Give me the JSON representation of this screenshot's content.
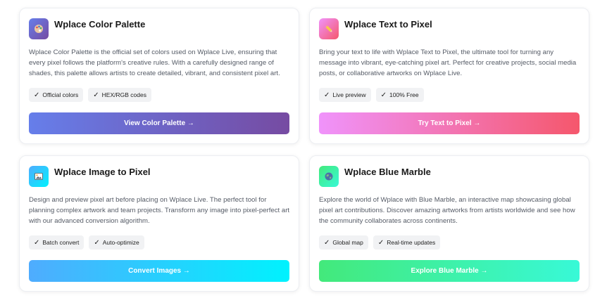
{
  "cards": [
    {
      "title": "Wplace Color Palette",
      "description": "Wplace Color Palette is the official set of colors used on Wplace Live, ensuring that every pixel follows the platform's creative rules. With a carefully designed range of shades, this palette allows artists to create detailed, vibrant, and consistent pixel art.",
      "tags": [
        "Official colors",
        "HEX/RGB codes"
      ],
      "button": "View Color Palette →",
      "icon": "palette-icon",
      "colors": {
        "gradient_start": "#667eea",
        "gradient_end": "#764ba2"
      }
    },
    {
      "title": "Wplace Text to Pixel",
      "description": "Bring your text to life with Wplace Text to Pixel, the ultimate tool for turning any message into vibrant, eye-catching pixel art. Perfect for creative projects, social media posts, or collaborative artworks on Wplace Live.",
      "tags": [
        "Live preview",
        "100% Free"
      ],
      "button": "Try Text to Pixel →",
      "icon": "pencil-icon",
      "colors": {
        "gradient_start": "#f093fb",
        "gradient_end": "#f5576c"
      }
    },
    {
      "title": "Wplace Image to Pixel",
      "description": "Design and preview pixel art before placing on Wplace Live. The perfect tool for planning complex artwork and team projects. Transform any image into pixel-perfect art with our advanced conversion algorithm.",
      "tags": [
        "Batch convert",
        "Auto-optimize"
      ],
      "button": "Convert Images →",
      "icon": "image-icon",
      "colors": {
        "gradient_start": "#4facfe",
        "gradient_end": "#00f2fe"
      }
    },
    {
      "title": "Wplace Blue Marble",
      "description": "Explore the world of Wplace with Blue Marble, an interactive map showcasing global pixel art contributions. Discover amazing artworks from artists worldwide and see how the community collaborates across continents.",
      "tags": [
        "Global map",
        "Real-time updates"
      ],
      "button": "Explore Blue Marble →",
      "icon": "globe-icon",
      "colors": {
        "gradient_start": "#43e97b",
        "gradient_end": "#38f9d7"
      }
    }
  ]
}
